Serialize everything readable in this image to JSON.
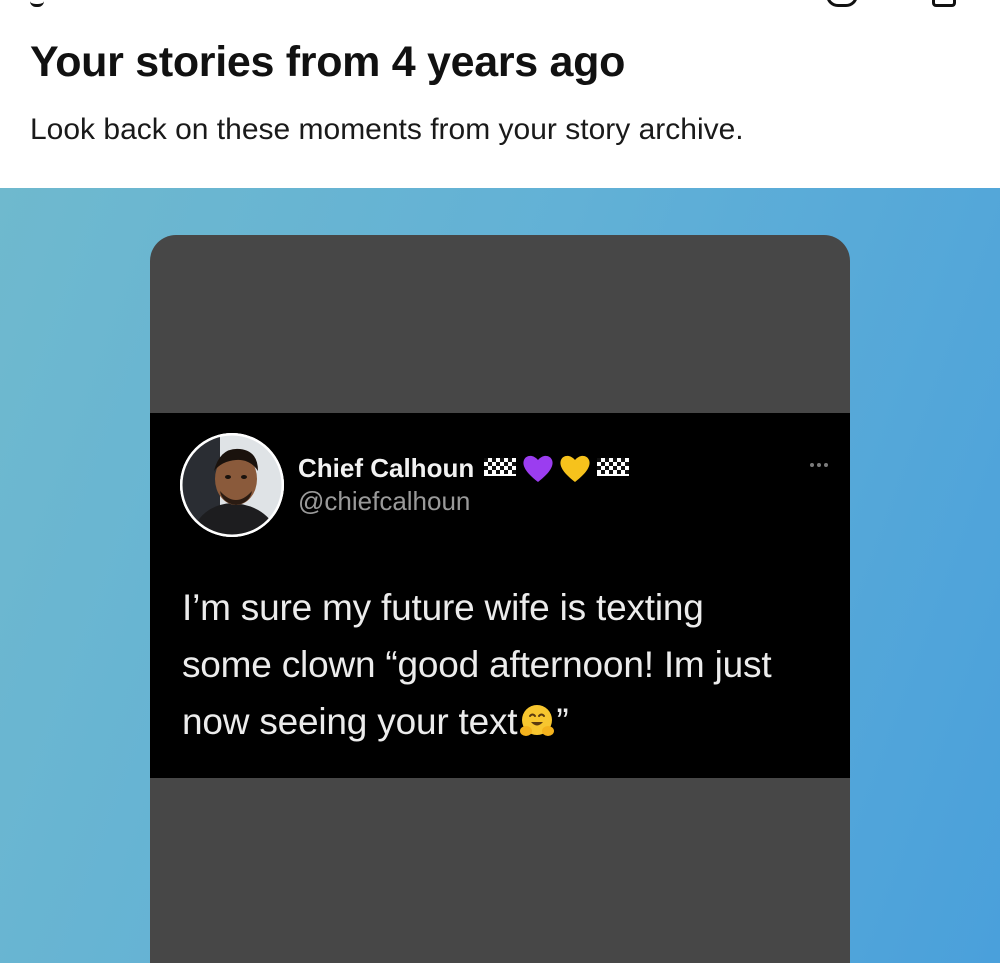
{
  "header": {
    "title": "Your stories from 4 years ago",
    "subtitle": "Look back on these moments from your story archive."
  },
  "story": {
    "background_colors": [
      "#6fb9ce",
      "#4aa0db"
    ],
    "card_color": "#474747",
    "tweet": {
      "name": "Chief Calhoun",
      "name_emojis": [
        "checkered-flag-icon",
        "purple-heart-icon",
        "yellow-heart-icon",
        "checkered-flag-icon"
      ],
      "handle": "@chiefcalhoun",
      "text_lines": [
        "I’m sure my future wife is texting",
        "some clown “good afternoon! Im just",
        "now seeing your text"
      ],
      "text_end": "”",
      "trailing_emoji": "hugging-face-icon",
      "more_icon": "more-dots-icon"
    }
  }
}
